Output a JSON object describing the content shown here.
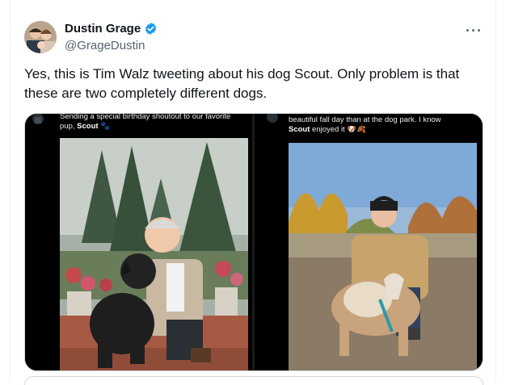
{
  "author": {
    "name": "Dustin Grage",
    "handle": "@GrageDustin"
  },
  "tweet": {
    "text": "Yes, this is Tim Walz tweeting about his dog Scout. Only problem is that these are two completely different dogs."
  },
  "media": {
    "left_caption_pre": "Sending a special birthday shoutout to our favorite pup,",
    "left_caption_name": "Scout",
    "right_caption_pre": "beautiful fall day than at the dog park. I know",
    "right_caption_name": "Scout",
    "right_caption_post": "enjoyed it"
  },
  "icons": {
    "verified": "verified-badge-icon",
    "more": "more-options-icon"
  },
  "colors": {
    "verified_blue": "#1d9bf0",
    "secondary_text": "#536471"
  }
}
